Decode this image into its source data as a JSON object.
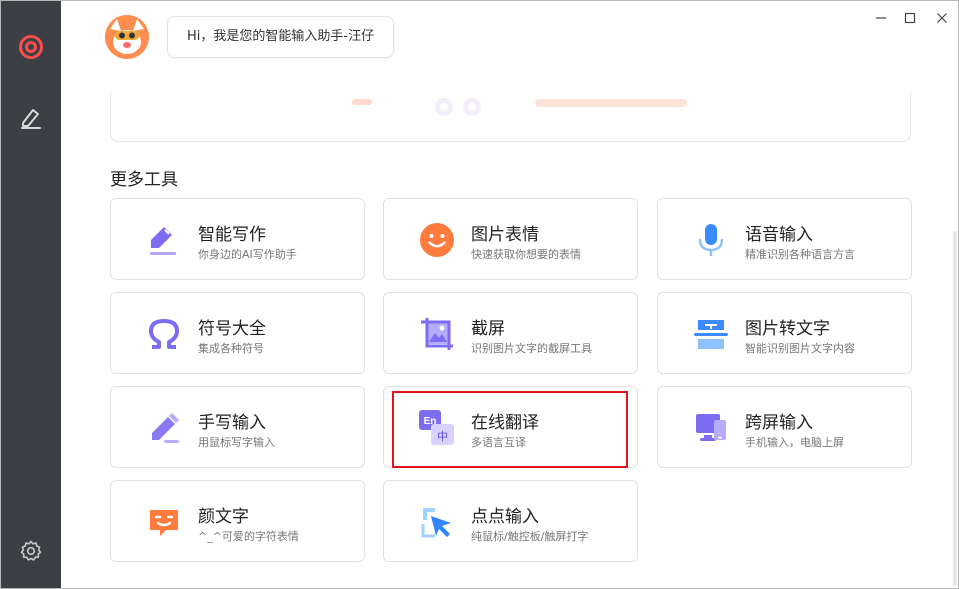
{
  "assistant": {
    "greeting": "Hi，我是您的智能输入助手-汪仔"
  },
  "sidebar": {
    "items": [
      {
        "name": "home",
        "icon": "target-logo-icon"
      },
      {
        "name": "write",
        "icon": "pen-icon"
      },
      {
        "name": "settings",
        "icon": "gear-icon"
      }
    ]
  },
  "section": {
    "title": "更多工具"
  },
  "tools": [
    {
      "name": "智能写作",
      "desc": "你身边的AI写作助手",
      "icon": "ai-writing-icon"
    },
    {
      "name": "图片表情",
      "desc": "快速获取你想要的表情",
      "icon": "smiley-icon"
    },
    {
      "name": "语音输入",
      "desc": "精准识别各种语言方言",
      "icon": "microphone-icon"
    },
    {
      "name": "符号大全",
      "desc": "集成各种符号",
      "icon": "omega-icon"
    },
    {
      "name": "截屏",
      "desc": "识别图片文字的截屏工具",
      "icon": "screenshot-icon"
    },
    {
      "name": "图片转文字",
      "desc": "智能识别图片文字内容",
      "icon": "image-to-text-icon"
    },
    {
      "name": "手写输入",
      "desc": "用鼠标写字输入",
      "icon": "handwriting-icon"
    },
    {
      "name": "在线翻译",
      "desc": "多语言互译",
      "icon": "translate-icon"
    },
    {
      "name": "跨屏输入",
      "desc": "手机输入，电脑上屏",
      "icon": "cross-screen-icon"
    },
    {
      "name": "颜文字",
      "desc": "^_^可爱的字符表情",
      "icon": "emoticon-icon"
    },
    {
      "name": "点点输入",
      "desc": "纯鼠标/触控板/触屏打字",
      "icon": "cursor-click-icon"
    }
  ],
  "translate_badge": {
    "en": "En",
    "zh": "中"
  },
  "colors": {
    "sidebar_bg": "#3c3f44",
    "accent_orange": "#ff6a3d",
    "accent_purple": "#8a6cf0",
    "accent_blue": "#3b8bff",
    "highlight_red": "#e0141c"
  }
}
